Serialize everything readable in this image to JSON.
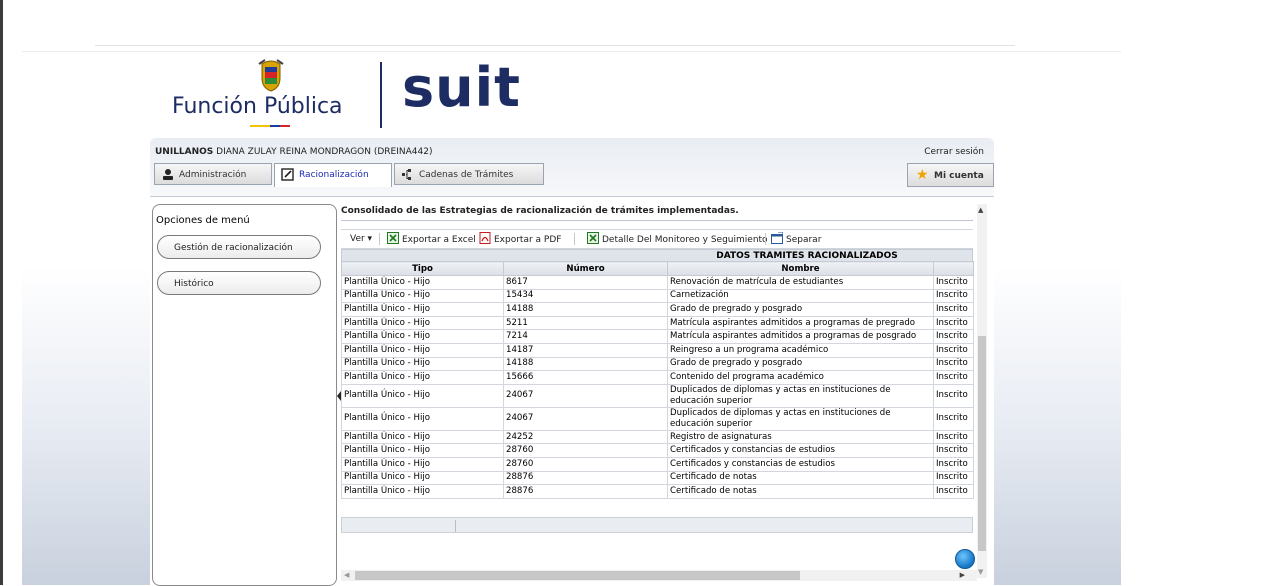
{
  "header": {
    "brand_left": "Función Pública",
    "brand_right": "suit"
  },
  "user": {
    "entity": "UNILLANOS",
    "name": "DIANA ZULAY REINA MONDRAGON (DREINA442)",
    "logout": "Cerrar sesión"
  },
  "tabs": [
    {
      "label": "Administración",
      "icon": "admin-users-icon"
    },
    {
      "label": "Racionalización",
      "icon": "edit-icon",
      "active": true
    },
    {
      "label": "Cadenas de Trámites",
      "icon": "chain-icon"
    }
  ],
  "account": {
    "label": "Mi cuenta",
    "icon": "star-icon"
  },
  "sidebar": {
    "title": "Opciones de menú",
    "items": [
      {
        "label": "Gestión de racionalización"
      },
      {
        "label": "Histórico"
      }
    ]
  },
  "content": {
    "title": "Consolidado de las Estrategias de racionalización de trámites implementadas.",
    "toolbar": {
      "view": "Ver ▾",
      "excel": "Exportar a Excel",
      "pdf": "Exportar a PDF",
      "detail": "Detalle Del Monitoreo y Seguimiento",
      "separate": "Separar"
    },
    "grid_title": "DATOS TRAMITES RACIONALIZADOS",
    "columns": [
      "Tipo",
      "Número",
      "Nombre",
      ""
    ],
    "rows": [
      [
        "Plantilla Único - Hijo",
        "8617",
        "Renovación de matrícula de estudiantes",
        "Inscrito"
      ],
      [
        "Plantilla Único - Hijo",
        "15434",
        "Carnetización",
        "Inscrito"
      ],
      [
        "Plantilla Único - Hijo",
        "14188",
        "Grado de pregrado y posgrado",
        "Inscrito"
      ],
      [
        "Plantilla Único - Hijo",
        "5211",
        "Matrícula aspirantes admitidos a programas de pregrado",
        "Inscrito"
      ],
      [
        "Plantilla Único - Hijo",
        "7214",
        "Matrícula aspirantes admitidos a programas de posgrado",
        "Inscrito"
      ],
      [
        "Plantilla Único - Hijo",
        "14187",
        "Reingreso a un programa académico",
        "Inscrito"
      ],
      [
        "Plantilla Único - Hijo",
        "14188",
        "Grado de pregrado y posgrado",
        "Inscrito"
      ],
      [
        "Plantilla Único - Hijo",
        "15666",
        "Contenido del programa académico",
        "Inscrito"
      ],
      [
        "Plantilla Único - Hijo",
        "24067",
        "Duplicados de diplomas y actas en instituciones de educación superior",
        "Inscrito"
      ],
      [
        "Plantilla Único - Hijo",
        "24067",
        "Duplicados de diplomas y actas en instituciones de educación superior",
        "Inscrito"
      ],
      [
        "Plantilla Único - Hijo",
        "24252",
        "Registro de asignaturas",
        "Inscrito"
      ],
      [
        "Plantilla Único - Hijo",
        "28760",
        "Certificados y constancias de estudios",
        "Inscrito"
      ],
      [
        "Plantilla Único - Hijo",
        "28760",
        "Certificados y constancias de estudios",
        "Inscrito"
      ],
      [
        "Plantilla Único - Hijo",
        "28876",
        "Certificado de notas",
        "Inscrito"
      ],
      [
        "Plantilla Único - Hijo",
        "28876",
        "Certificado de notas",
        "Inscrito"
      ]
    ]
  }
}
